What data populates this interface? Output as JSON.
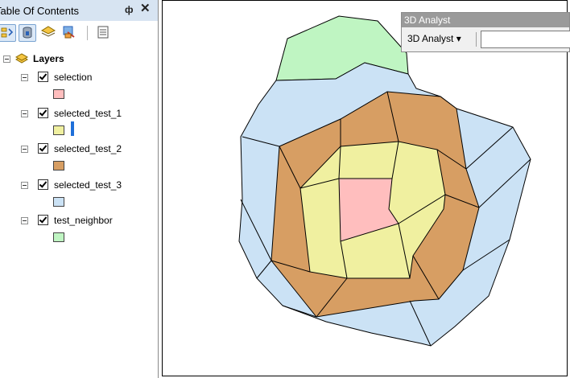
{
  "toc": {
    "title": "Table Of Contents",
    "pin_glyph": "ф",
    "close_glyph": "✕",
    "toolbar": [
      {
        "name": "list-by-drawing-order",
        "icon": "list-by-drawing-order-icon",
        "pressed": true
      },
      {
        "name": "list-by-source",
        "icon": "list-by-source-icon",
        "pressed": true
      },
      {
        "name": "list-by-visibility",
        "icon": "list-by-visibility-icon",
        "pressed": false
      },
      {
        "name": "list-by-selection",
        "icon": "list-by-selection-icon",
        "pressed": false
      },
      {
        "name": "options",
        "icon": "options-icon",
        "pressed": false
      }
    ],
    "root": {
      "label": "Layers",
      "icon": "layers-icon"
    },
    "layers": [
      {
        "label": "selection",
        "checked": true,
        "color": "#ffbebe"
      },
      {
        "label": "selected_test_1",
        "checked": true,
        "color": "#f0f0a0"
      },
      {
        "label": "selected_test_2",
        "checked": true,
        "color": "#d79e63"
      },
      {
        "label": "selected_test_3",
        "checked": true,
        "color": "#cbe2f5"
      },
      {
        "label": "test_neighbor",
        "checked": true,
        "color": "#bff5c2"
      }
    ]
  },
  "analyst_toolbar": {
    "title": "3D Analyst",
    "menu_label": "3D Analyst",
    "dropdown_glyph": "▾",
    "layer_value": ""
  },
  "colors": {
    "outline": "#000000",
    "title_bar": "#d7e4f2",
    "cursor": "#1e6fd9"
  }
}
